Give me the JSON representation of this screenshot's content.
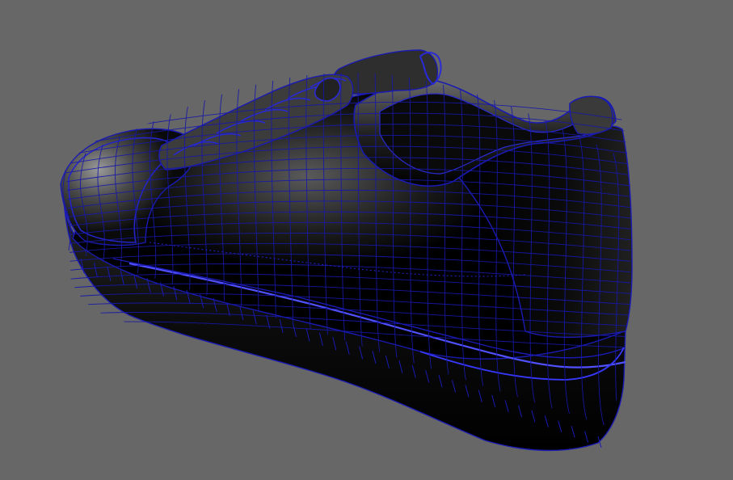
{
  "viewport": {
    "background_color": "#676767",
    "subject": "sneaker-wireframe-model",
    "wire_color": "#1a1ab4",
    "wire_highlight_color": "#3a3aff",
    "shade_dark": "#000000",
    "shade_light": "#8a8a8a"
  }
}
